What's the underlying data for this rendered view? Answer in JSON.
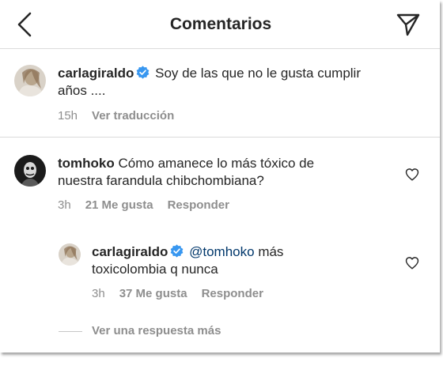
{
  "header": {
    "title": "Comentarios",
    "back_icon": "chevron-left-icon",
    "send_icon": "paper-plane-icon"
  },
  "caption": {
    "username": "carlagiraldo",
    "verified": true,
    "text_line1": "Soy de las que no le gusta cumplir",
    "text_line2": "años ....",
    "time": "15h",
    "translate": "Ver traducción"
  },
  "comments": [
    {
      "username": "tomhoko",
      "text_line1": "Cómo amanece lo más tóxico de",
      "text_line2": "nuestra farandula chibchombiana?",
      "time": "3h",
      "likes": "21 Me gusta",
      "reply": "Responder"
    }
  ],
  "replies": [
    {
      "username": "carlagiraldo",
      "verified": true,
      "mention": "@tomhoko",
      "text_after_mention": "más",
      "text_line2": "toxicolombia q nunca",
      "time": "3h",
      "likes": "37 Me gusta",
      "reply": "Responder"
    }
  ],
  "view_more": "Ver una respuesta más",
  "colors": {
    "verified": "#3897f0",
    "secondary_text": "#8e8e8e",
    "mention": "#00376b"
  }
}
